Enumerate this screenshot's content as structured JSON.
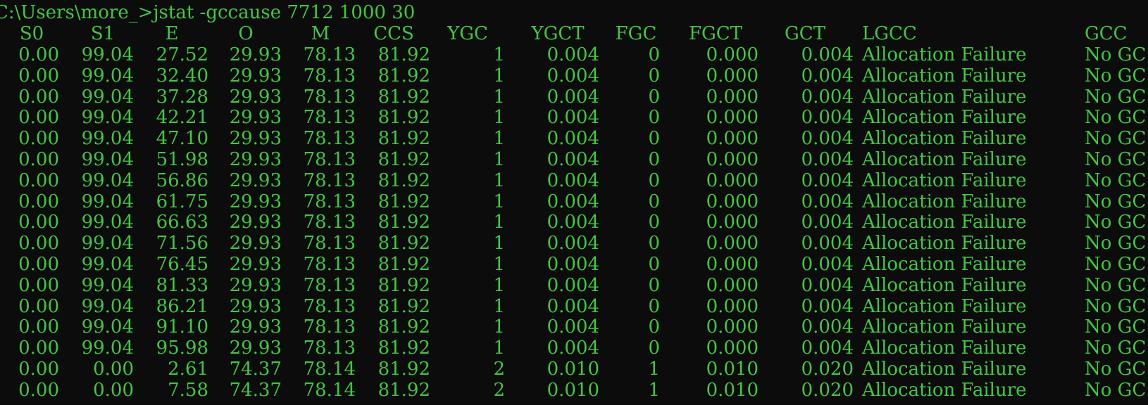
{
  "prompt": "C:\\Users\\more_>jstat -gccause 7712 1000 30",
  "columns": [
    "S0",
    "S1",
    "E",
    "O",
    "M",
    "CCS",
    "YGC",
    "YGCT",
    "FGC",
    "FGCT",
    "GCT",
    "LGCC",
    "GCC"
  ],
  "rows": [
    [
      "0.00",
      "99.04",
      "27.52",
      "29.93",
      "78.13",
      "81.92",
      "1",
      "0.004",
      "0",
      "0.000",
      "0.004",
      "Allocation Failure",
      "No GC"
    ],
    [
      "0.00",
      "99.04",
      "32.40",
      "29.93",
      "78.13",
      "81.92",
      "1",
      "0.004",
      "0",
      "0.000",
      "0.004",
      "Allocation Failure",
      "No GC"
    ],
    [
      "0.00",
      "99.04",
      "37.28",
      "29.93",
      "78.13",
      "81.92",
      "1",
      "0.004",
      "0",
      "0.000",
      "0.004",
      "Allocation Failure",
      "No GC"
    ],
    [
      "0.00",
      "99.04",
      "42.21",
      "29.93",
      "78.13",
      "81.92",
      "1",
      "0.004",
      "0",
      "0.000",
      "0.004",
      "Allocation Failure",
      "No GC"
    ],
    [
      "0.00",
      "99.04",
      "47.10",
      "29.93",
      "78.13",
      "81.92",
      "1",
      "0.004",
      "0",
      "0.000",
      "0.004",
      "Allocation Failure",
      "No GC"
    ],
    [
      "0.00",
      "99.04",
      "51.98",
      "29.93",
      "78.13",
      "81.92",
      "1",
      "0.004",
      "0",
      "0.000",
      "0.004",
      "Allocation Failure",
      "No GC"
    ],
    [
      "0.00",
      "99.04",
      "56.86",
      "29.93",
      "78.13",
      "81.92",
      "1",
      "0.004",
      "0",
      "0.000",
      "0.004",
      "Allocation Failure",
      "No GC"
    ],
    [
      "0.00",
      "99.04",
      "61.75",
      "29.93",
      "78.13",
      "81.92",
      "1",
      "0.004",
      "0",
      "0.000",
      "0.004",
      "Allocation Failure",
      "No GC"
    ],
    [
      "0.00",
      "99.04",
      "66.63",
      "29.93",
      "78.13",
      "81.92",
      "1",
      "0.004",
      "0",
      "0.000",
      "0.004",
      "Allocation Failure",
      "No GC"
    ],
    [
      "0.00",
      "99.04",
      "71.56",
      "29.93",
      "78.13",
      "81.92",
      "1",
      "0.004",
      "0",
      "0.000",
      "0.004",
      "Allocation Failure",
      "No GC"
    ],
    [
      "0.00",
      "99.04",
      "76.45",
      "29.93",
      "78.13",
      "81.92",
      "1",
      "0.004",
      "0",
      "0.000",
      "0.004",
      "Allocation Failure",
      "No GC"
    ],
    [
      "0.00",
      "99.04",
      "81.33",
      "29.93",
      "78.13",
      "81.92",
      "1",
      "0.004",
      "0",
      "0.000",
      "0.004",
      "Allocation Failure",
      "No GC"
    ],
    [
      "0.00",
      "99.04",
      "86.21",
      "29.93",
      "78.13",
      "81.92",
      "1",
      "0.004",
      "0",
      "0.000",
      "0.004",
      "Allocation Failure",
      "No GC"
    ],
    [
      "0.00",
      "99.04",
      "91.10",
      "29.93",
      "78.13",
      "81.92",
      "1",
      "0.004",
      "0",
      "0.000",
      "0.004",
      "Allocation Failure",
      "No GC"
    ],
    [
      "0.00",
      "99.04",
      "95.98",
      "29.93",
      "78.13",
      "81.92",
      "1",
      "0.004",
      "0",
      "0.000",
      "0.004",
      "Allocation Failure",
      "No GC"
    ],
    [
      "0.00",
      "0.00",
      "2.61",
      "74.37",
      "78.14",
      "81.92",
      "2",
      "0.010",
      "1",
      "0.010",
      "0.020",
      "Allocation Failure",
      "No GC"
    ],
    [
      "0.00",
      "0.00",
      "7.58",
      "74.37",
      "78.14",
      "81.92",
      "2",
      "0.010",
      "1",
      "0.010",
      "0.020",
      "Allocation Failure",
      "No GC"
    ]
  ],
  "colors": {
    "background": "#0c0c0c",
    "text": "#3ec93e"
  }
}
